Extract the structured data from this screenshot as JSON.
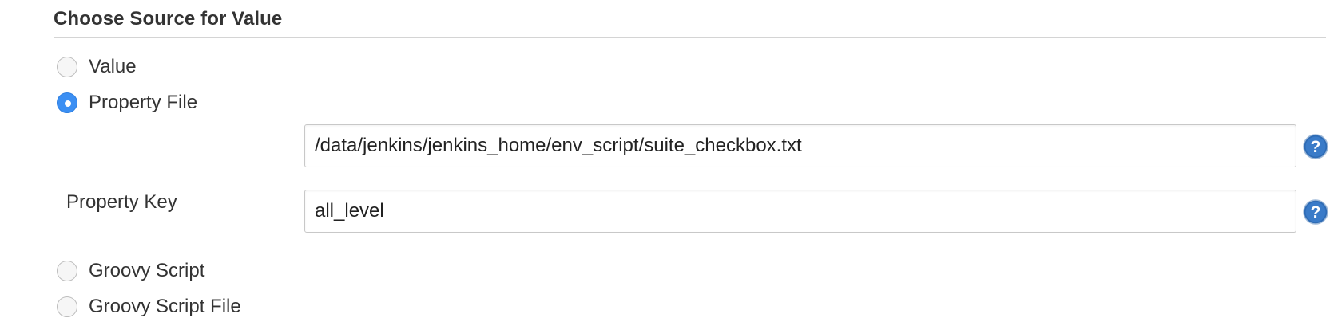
{
  "section": {
    "title": "Choose Source for Value"
  },
  "options": {
    "value": {
      "label": "Value",
      "checked": false
    },
    "property_file": {
      "label": "Property File",
      "checked": true
    },
    "groovy_script": {
      "label": "Groovy Script",
      "checked": false
    },
    "groovy_script_file": {
      "label": "Groovy Script File",
      "checked": false
    }
  },
  "property_file_path": {
    "value": "/data/jenkins/jenkins_home/env_script/suite_checkbox.txt"
  },
  "property_key": {
    "label": "Property Key",
    "value": "all_level"
  },
  "icons": {
    "help": "help-icon"
  },
  "colors": {
    "radio_selected": "#3b8ff3",
    "help_icon": "#2f6cb5"
  }
}
